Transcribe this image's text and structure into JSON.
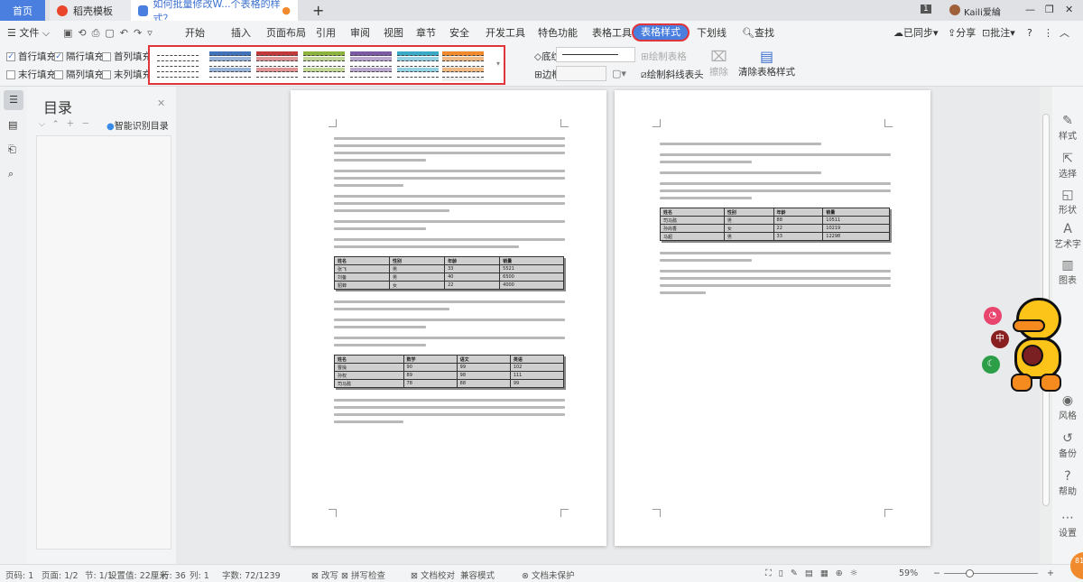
{
  "tabs": {
    "home": "首页",
    "template": "稻壳模板",
    "doc": "如何批量修改W...个表格的样式？",
    "new_tab": "+"
  },
  "window": {
    "badge": "1",
    "user": "Kaili爱綸",
    "minimize": "—",
    "restore": "❐",
    "close": "✕"
  },
  "menu": {
    "file": "文件",
    "items": [
      "开始",
      "插入",
      "页面布局",
      "引用",
      "审阅",
      "视图",
      "章节",
      "安全",
      "开发工具",
      "特色功能",
      "表格工具",
      "表格样式",
      "下划线"
    ],
    "search": "查找",
    "sync": "已同步",
    "share": "分享",
    "comment": "批注",
    "help": "?"
  },
  "ribbon": {
    "checks": [
      {
        "label": "首行填充",
        "checked": true
      },
      {
        "label": "隔行填充",
        "checked": true
      },
      {
        "label": "首列填充",
        "checked": false
      },
      {
        "label": "末行填充",
        "checked": false
      },
      {
        "label": "隔列填充",
        "checked": false
      },
      {
        "label": "末列填充",
        "checked": false
      }
    ],
    "styles": [
      {
        "color": "#ffffff"
      },
      {
        "color": "#3f72b8"
      },
      {
        "color": "#c0393b"
      },
      {
        "color": "#8db33e"
      },
      {
        "color": "#7b5aa3"
      },
      {
        "color": "#3aa9c6"
      },
      {
        "color": "#f08a2c"
      }
    ],
    "shading": "底纹",
    "border": "边框",
    "draw_table": "绘制表格",
    "draw_diagonal": "绘制斜线表头",
    "erase": "擦除",
    "clear_style": "清除表格样式"
  },
  "nav": {
    "title": "目录",
    "smart": "智能识别目录"
  },
  "doc": {
    "table1": [
      [
        "姓名",
        "性别",
        "年龄",
        "销量"
      ],
      [
        "张飞",
        "男",
        "33",
        "5521"
      ],
      [
        "刘备",
        "男",
        "40",
        "6500"
      ],
      [
        "貂蝉",
        "女",
        "22",
        "4000"
      ]
    ],
    "table2": [
      [
        "姓名",
        "数学",
        "语文",
        "英语"
      ],
      [
        "曹操",
        "90",
        "99",
        "102"
      ],
      [
        "孙权",
        "89",
        "98",
        "111"
      ],
      [
        "司马懿",
        "78",
        "88",
        "99"
      ]
    ],
    "table3": [
      [
        "姓名",
        "性别",
        "年龄",
        "销量"
      ],
      [
        "司马懿",
        "男",
        "88",
        "10511"
      ],
      [
        "孙尚香",
        "女",
        "22",
        "10219"
      ],
      [
        "马超",
        "男",
        "33",
        "12298"
      ]
    ]
  },
  "sidebar": [
    "样式",
    "选择",
    "形状",
    "艺术字",
    "图表",
    "风格",
    "备份",
    "帮助",
    "设置"
  ],
  "status": {
    "page": "页码: 1",
    "pages": "页面: 1/2",
    "section": "节: 1/1",
    "setting": "设置值: 22厘米",
    "row": "行: 36",
    "col": "列: 1",
    "words": "字数: 72/1239",
    "revise": "改写",
    "spell": "拼写检查",
    "proof": "文档校对",
    "compat": "兼容模式",
    "protect": "文档未保护",
    "zoom": "59%"
  },
  "accent": "#4a7fe0"
}
